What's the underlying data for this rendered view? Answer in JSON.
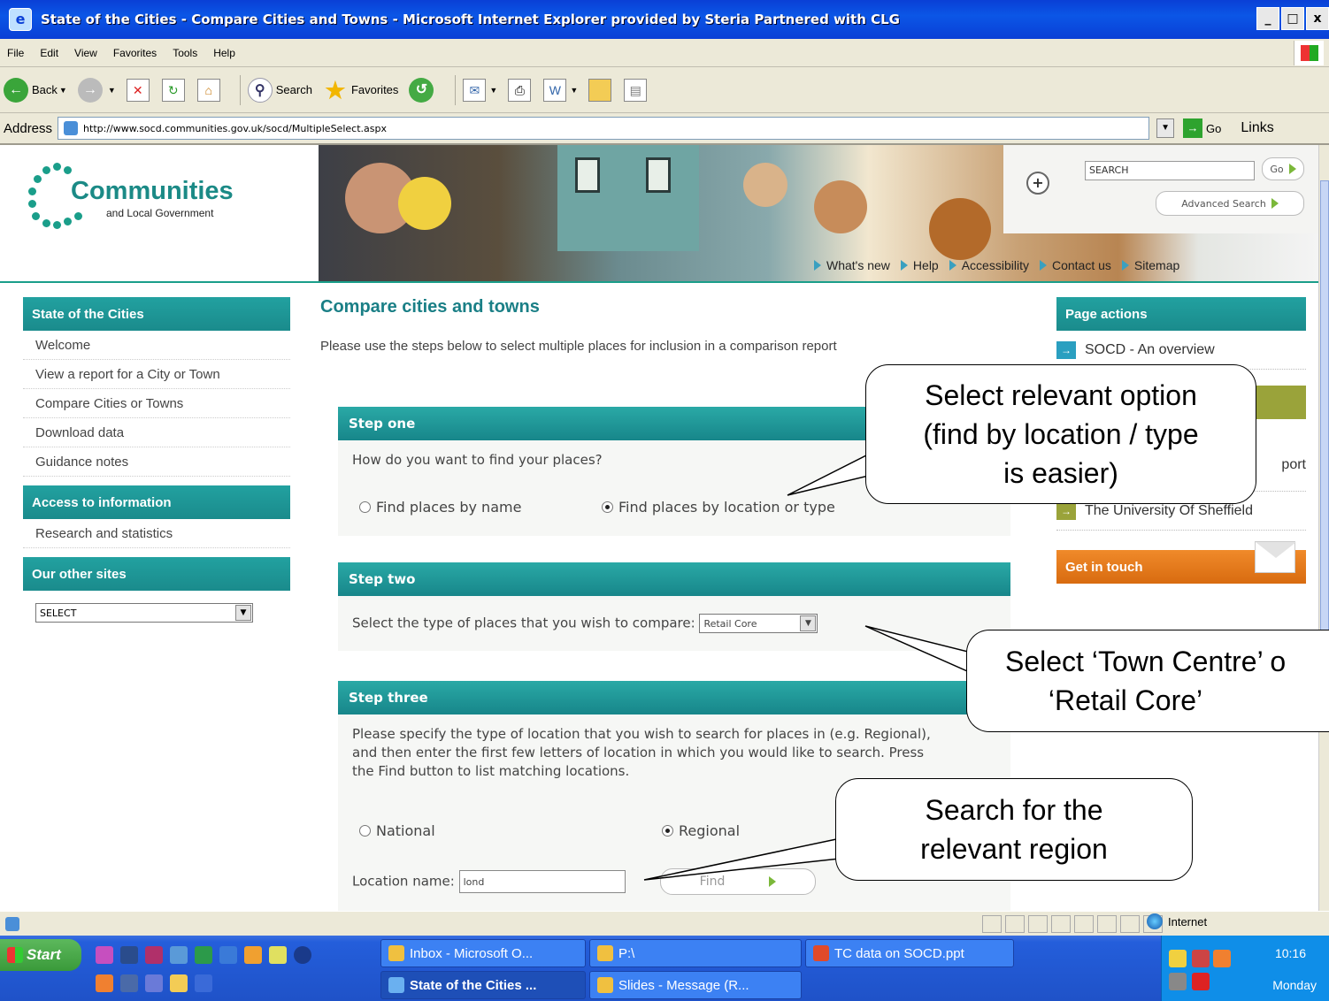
{
  "window": {
    "title": "State of the Cities - Compare Cities and Towns - Microsoft Internet Explorer provided by Steria Partnered with CLG",
    "buttons": [
      "_",
      "□",
      "x"
    ]
  },
  "menu": [
    "File",
    "Edit",
    "View",
    "Favorites",
    "Tools",
    "Help"
  ],
  "toolbar": {
    "back": "Back",
    "search": "Search",
    "favorites": "Favorites"
  },
  "address": {
    "label": "Address",
    "url": "http://www.socd.communities.gov.uk/socd/MultipleSelect.aspx",
    "go": "Go",
    "links": "Links"
  },
  "site": {
    "logo_main": "Communities",
    "logo_sub": "and Local Government",
    "search_placeholder": "SEARCH",
    "search_go": "Go",
    "advanced_search": "Advanced Search",
    "utility_links": [
      "What's new",
      "Help",
      "Accessibility",
      "Contact us",
      "Sitemap"
    ]
  },
  "leftnav": {
    "section1": "State of the Cities",
    "items1": [
      "Welcome",
      "View a report for a City or Town",
      "Compare Cities or Towns",
      "Download data",
      "Guidance notes"
    ],
    "section2": "Access to information",
    "items2": [
      "Research and statistics"
    ],
    "section3": "Our other sites",
    "select_value": "SELECT"
  },
  "main": {
    "title": "Compare cities and towns",
    "intro": "Please use the steps below to select multiple places for inclusion in a comparison report",
    "step1": {
      "heading": "Step one",
      "question": "How do you want to find your places?",
      "option_name": "Find places by name",
      "option_location": "Find places by location or type"
    },
    "step2": {
      "heading": "Step two",
      "prompt": "Select the type of places that you wish to compare:",
      "select_value": "Retail Core"
    },
    "step3": {
      "heading": "Step three",
      "instructions": "Please specify the type of location that you wish to search for places in (e.g. Regional), and then enter the first few letters of location in which you would like to search. Press the Find button to list matching locations.",
      "option_national": "National",
      "option_regional": "Regional",
      "location_label": "Location name:",
      "location_value": "lond",
      "find_button": "Find"
    }
  },
  "rightcol": {
    "heading": "Page actions",
    "item1": "SOCD - An overview",
    "item2_partial": "port",
    "item3": "The University Of Sheffield",
    "contact_heading": "Get in touch"
  },
  "callouts": {
    "c1": [
      "Select relevant option",
      "(find by location / type",
      "is easier)"
    ],
    "c2": [
      "Select ‘Town Centre’ o",
      "‘Retail Core’"
    ],
    "c3": [
      "Search for the",
      "relevant region"
    ]
  },
  "statusbar": {
    "zone": "Internet"
  },
  "taskbar": {
    "start": "Start",
    "tasks": [
      "Inbox - Microsoft O...",
      "P:\\",
      "TC data on SOCD.ppt",
      "State of the Cities ...",
      "Slides - Message (R..."
    ],
    "time": "10:16",
    "day": "Monday"
  }
}
